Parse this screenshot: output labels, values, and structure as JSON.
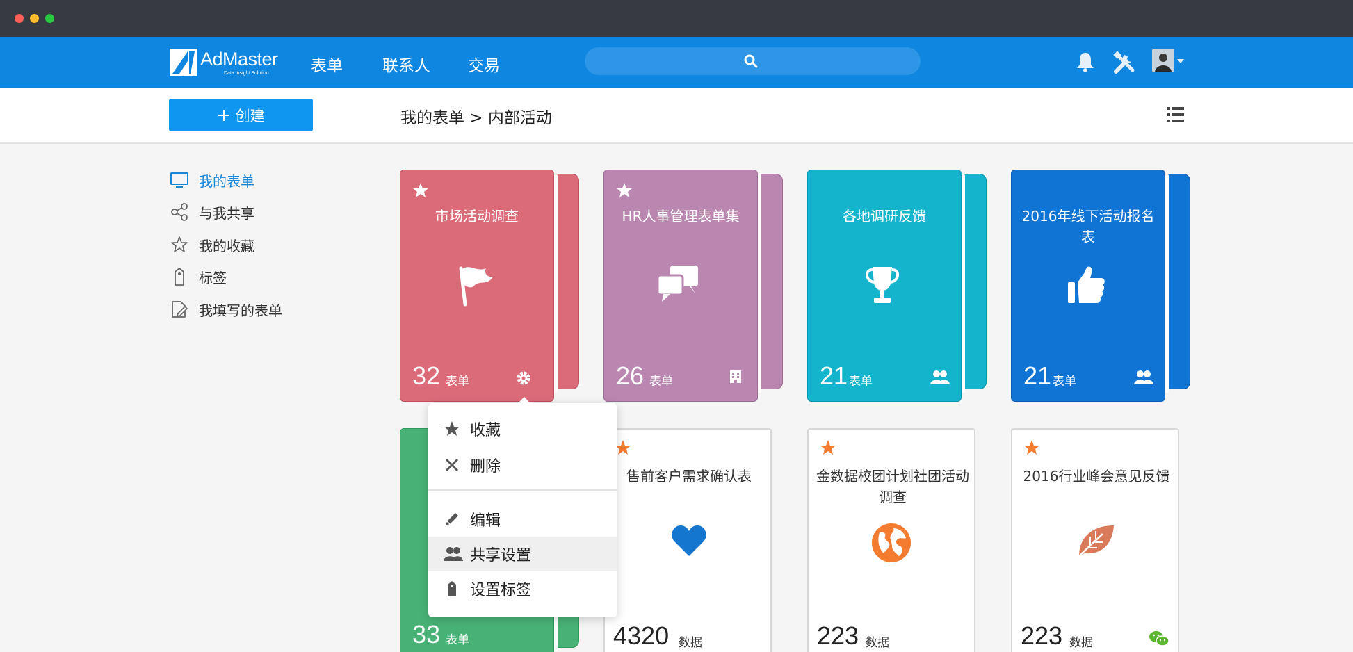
{
  "nav": {
    "logo_text": "AdMaster",
    "logo_tagline": "Data Insight Solution",
    "links": [
      "表单",
      "联系人",
      "交易"
    ],
    "search_placeholder": ""
  },
  "toolbar": {
    "create_label": "创建",
    "breadcrumb": "我的表单 > 内部活动"
  },
  "sidebar": {
    "items": [
      {
        "label": "我的表单",
        "icon": "monitor-icon",
        "active": true
      },
      {
        "label": "与我共享",
        "icon": "share-icon",
        "active": false
      },
      {
        "label": "我的收藏",
        "icon": "star-outline-icon",
        "active": false
      },
      {
        "label": "标签",
        "icon": "tag-icon",
        "active": false
      },
      {
        "label": "我填写的表单",
        "icon": "edit-doc-icon",
        "active": false
      }
    ]
  },
  "folders": [
    {
      "title": "市场活动调查",
      "count": "32",
      "unit": "表单",
      "color": "#dc6b7a",
      "icon": "flag-icon",
      "starred": true
    },
    {
      "title": "HR人事管理表单集",
      "count": "26",
      "unit": "表单",
      "color": "#b987b0",
      "icon": "chat-icon",
      "starred": true
    },
    {
      "title": "各地调研反馈",
      "count": "21",
      "unit": "表单",
      "color": "#14b4cc",
      "icon": "trophy-icon",
      "starred": false
    },
    {
      "title": "2016年线下活动报名表",
      "count": "21",
      "unit": "表单",
      "color": "#1074d4",
      "icon": "thumbs-up-icon",
      "starred": false
    },
    {
      "title": "",
      "count": "33",
      "unit": "表单",
      "color": "#48b276",
      "icon": "",
      "starred": false
    }
  ],
  "forms": [
    {
      "title": "售前客户需求确认表",
      "count": "4320",
      "unit": "数据",
      "icon": "heart-icon",
      "icon_color": "#1576d0",
      "starred": true
    },
    {
      "title": "金数据校团计划社团活动调查",
      "count": "223",
      "unit": "数据",
      "icon": "globe-icon",
      "icon_color": "#f47c30",
      "starred": true
    },
    {
      "title": "2016行业峰会意见反馈",
      "count": "223",
      "unit": "数据",
      "icon": "leaf-icon",
      "icon_color": "#d97b5a",
      "starred": true
    }
  ],
  "menu": {
    "items": [
      {
        "label": "收藏",
        "icon": "star-icon"
      },
      {
        "label": "删除",
        "icon": "close-icon"
      },
      {
        "label": "编辑",
        "icon": "pencil-icon"
      },
      {
        "label": "共享设置",
        "icon": "users-icon",
        "hover": true
      },
      {
        "label": "设置标签",
        "icon": "tag-icon"
      }
    ]
  }
}
